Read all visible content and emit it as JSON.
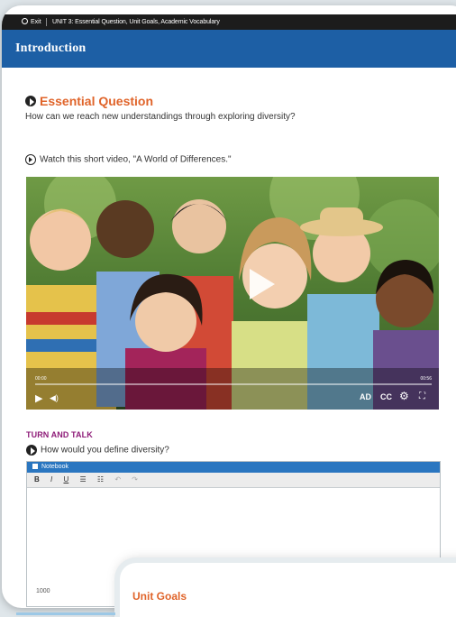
{
  "topbar": {
    "exit_label": "Exit",
    "unit_label": "UNIT 3: Essential Question, Unit Goals, Academic Vocabulary"
  },
  "intro": {
    "title": "Introduction"
  },
  "essential_question": {
    "heading": "Essential Question",
    "question": "How can we reach new understandings through exploring diversity?"
  },
  "video": {
    "prompt": "Watch this short video, \"A World of Differences.\"",
    "current_time": "00:00",
    "duration": "00:56",
    "progress": 0,
    "ad_label": "AD",
    "cc_label": "CC"
  },
  "turn_and_talk": {
    "heading": "TURN AND TALK",
    "question": "How would you define diversity?"
  },
  "notebook": {
    "title": "Notebook",
    "tools": [
      "B",
      "I",
      "U",
      "bullet-list-icon",
      "numbered-list-icon",
      "undo-icon",
      "redo-icon"
    ],
    "content": "",
    "char_count": "1000"
  },
  "next_card": {
    "heading": "Unit Goals"
  },
  "colors": {
    "topbar": "#1c1c1c",
    "intro_bar": "#1d5fa5",
    "heading_orange": "#e0642a",
    "turn_and_talk": "#8e1c78",
    "notebook_header": "#2a76c0"
  }
}
